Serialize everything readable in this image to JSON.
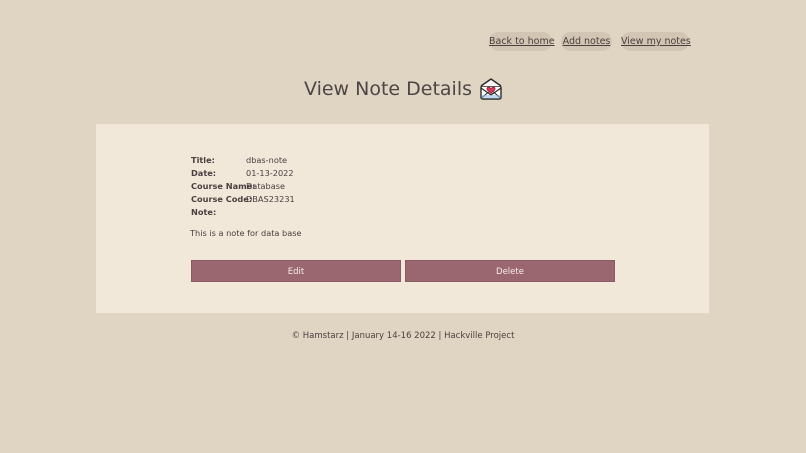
{
  "nav": {
    "back_home": "Back to home",
    "add_notes": "Add notes",
    "view_my_notes": "View my notes"
  },
  "page": {
    "title": "View Note Details",
    "title_icon": "love-letter-envelope-icon"
  },
  "note": {
    "fields": [
      {
        "label": "Title:",
        "value": "dbas-note"
      },
      {
        "label": "Date:",
        "value": "01-13-2022"
      },
      {
        "label": "Course Name:",
        "value": "Database"
      },
      {
        "label": "Course Code:",
        "value": "DBAS23231"
      },
      {
        "label": "Note:",
        "value": ""
      }
    ],
    "body": "This is a note for data base"
  },
  "actions": {
    "edit_label": "Edit",
    "delete_label": "Delete"
  },
  "footer": {
    "text": "© Hamstarz | January 14-16 2022 | Hackville Project"
  },
  "colors": {
    "background": "#e0d5c3",
    "card": "#f2e8da",
    "nav_pill": "#d2c5b3",
    "button": "#9a6670",
    "text": "#4a4040"
  }
}
